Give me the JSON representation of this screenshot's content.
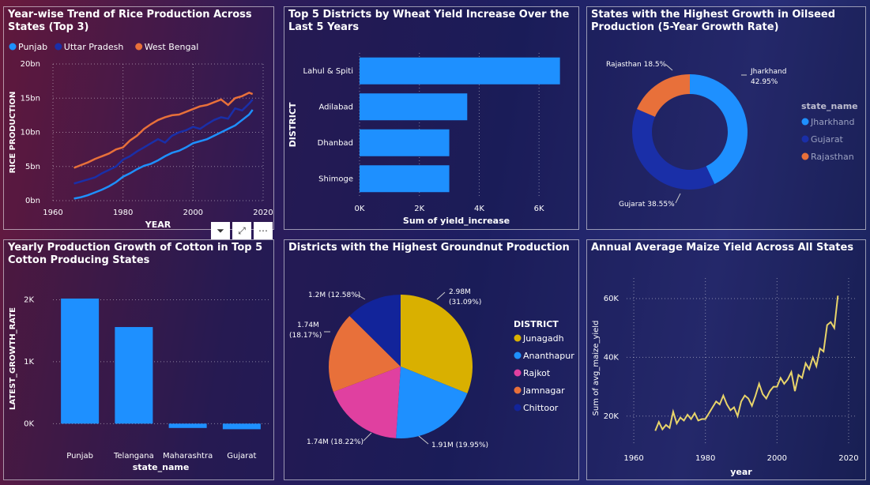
{
  "colors": {
    "blue": "#1e90ff",
    "navy": "#1a2fa8",
    "orange": "#e8703a",
    "pink": "#e040a0",
    "gold": "#d9b000",
    "yellow": "#e8d46a",
    "deepblue": "#12249a"
  },
  "toolbar": {
    "filter_icon": "filter-icon",
    "focus_icon": "focus-mode-icon",
    "more_icon": "more-options-icon",
    "filter_glyph": "⏷",
    "focus_glyph": "⤢",
    "more_glyph": "⋯"
  },
  "chart_data": [
    {
      "type": "line",
      "title": "Year-wise Trend of Rice Production Across States (Top 3)",
      "xlabel": "YEAR",
      "ylabel": "RICE PRODUCTION",
      "xticks": [
        "1960",
        "1980",
        "2000",
        "2020"
      ],
      "yticks": [
        "0bn",
        "5bn",
        "10bn",
        "15bn",
        "20bn"
      ],
      "xlim": [
        1960,
        2020
      ],
      "ylim": [
        0,
        20
      ],
      "legend": [
        "Punjab",
        "Uttar Pradesh",
        "West Bengal"
      ],
      "x": [
        1966,
        1968,
        1970,
        1972,
        1974,
        1976,
        1978,
        1980,
        1982,
        1984,
        1986,
        1988,
        1990,
        1992,
        1994,
        1996,
        1998,
        2000,
        2002,
        2004,
        2006,
        2008,
        2010,
        2012,
        2014,
        2016,
        2017
      ],
      "series": [
        {
          "name": "Punjab",
          "values": [
            0.3,
            0.5,
            0.8,
            1.2,
            1.6,
            2.1,
            2.7,
            3.5,
            4.0,
            4.6,
            5.1,
            5.4,
            5.9,
            6.5,
            7.0,
            7.3,
            7.8,
            8.4,
            8.7,
            9.0,
            9.5,
            10.0,
            10.5,
            11.0,
            11.8,
            12.6,
            13.3
          ]
        },
        {
          "name": "Uttar Pradesh",
          "values": [
            2.5,
            2.8,
            3.1,
            3.4,
            4.0,
            4.5,
            5.0,
            6.0,
            6.5,
            7.2,
            7.8,
            8.4,
            9.0,
            8.5,
            9.5,
            10.0,
            10.3,
            10.8,
            10.5,
            11.2,
            11.8,
            12.2,
            12.0,
            13.5,
            13.2,
            14.2,
            14.8
          ]
        },
        {
          "name": "West Bengal",
          "values": [
            4.8,
            5.2,
            5.6,
            6.1,
            6.5,
            6.9,
            7.5,
            7.8,
            8.8,
            9.5,
            10.5,
            11.2,
            11.8,
            12.2,
            12.5,
            12.6,
            13.0,
            13.4,
            13.8,
            14.0,
            14.4,
            14.8,
            14.0,
            15.0,
            15.3,
            15.8,
            15.6
          ]
        }
      ]
    },
    {
      "type": "bar",
      "title": "Top 5 Districts by Wheat Yield Increase Over the Last 5 Years",
      "xlabel": "Sum of yield_increase",
      "ylabel": "DISTRICT",
      "categories": [
        "Lahul & Spiti",
        "Adilabad",
        "Dhanbad",
        "Shimoge"
      ],
      "values": [
        6700,
        3600,
        3000,
        3000
      ],
      "xticks": [
        "0K",
        "2K",
        "4K",
        "6K"
      ],
      "xlim": [
        0,
        7000
      ]
    },
    {
      "type": "pie",
      "title": "States with the Highest Growth in Oilseed Production (5-Year Growth Rate)",
      "legend_title": "state_name",
      "categories": [
        "Jharkhand",
        "Gujarat",
        "Rajasthan"
      ],
      "values": [
        42.95,
        38.55,
        18.5
      ],
      "labels": [
        "Jharkhand",
        "42.95%",
        "Gujarat 38.55%",
        "Rajasthan 18.5%"
      ]
    },
    {
      "type": "bar",
      "title": "Yearly Production Growth of Cotton in Top 5 Cotton Producing States",
      "xlabel": "state_name",
      "ylabel": "LATEST_GROWTH_RATE",
      "categories": [
        "Punjab",
        "Telangana",
        "Maharashtra",
        "Gujarat"
      ],
      "values": [
        2020,
        1560,
        -70,
        -90
      ],
      "yticks": [
        "0K",
        "1K",
        "2K"
      ],
      "ylim": [
        -200,
        2300
      ]
    },
    {
      "type": "pie",
      "title": "Districts with the Highest Groundnut Production",
      "legend_title": "DISTRICT",
      "categories": [
        "Junagadh",
        "Ananthapur",
        "Rajkot",
        "Jamnagar",
        "Chittoor"
      ],
      "values": [
        31.09,
        19.95,
        18.22,
        18.17,
        12.58
      ],
      "labels": [
        "2.98M",
        "(31.09%)",
        "1.91M (19.95%)",
        "1.74M (18.22%)",
        "1.74M",
        "(18.17%)",
        "1.2M (12.58%)"
      ]
    },
    {
      "type": "line",
      "title": "Annual Average Maize Yield Across All States",
      "xlabel": "year",
      "ylabel": "Sum of avg_maize_yield",
      "xticks": [
        "1960",
        "1980",
        "2000",
        "2020"
      ],
      "yticks": [
        "20K",
        "40K",
        "60K"
      ],
      "xlim": [
        1958,
        2022
      ],
      "ylim": [
        10000,
        67000
      ],
      "x": [
        1966,
        1967,
        1968,
        1969,
        1970,
        1971,
        1972,
        1973,
        1974,
        1975,
        1976,
        1977,
        1978,
        1979,
        1980,
        1981,
        1982,
        1983,
        1984,
        1985,
        1986,
        1987,
        1988,
        1989,
        1990,
        1991,
        1992,
        1993,
        1994,
        1995,
        1996,
        1997,
        1998,
        1999,
        2000,
        2001,
        2002,
        2003,
        2004,
        2005,
        2006,
        2007,
        2008,
        2009,
        2010,
        2011,
        2012,
        2013,
        2014,
        2015,
        2016,
        2017
      ],
      "values": [
        15000,
        18000,
        15500,
        17000,
        16000,
        21500,
        17500,
        19500,
        18500,
        20500,
        19000,
        21000,
        18500,
        19000,
        19000,
        21000,
        23000,
        25000,
        24000,
        27000,
        24000,
        22000,
        23000,
        20000,
        25000,
        27000,
        26000,
        23500,
        27000,
        31000,
        27500,
        26000,
        28500,
        30000,
        30000,
        33000,
        31000,
        32500,
        35000,
        28500,
        34000,
        33000,
        38000,
        36000,
        40000,
        37000,
        43000,
        42000,
        51000,
        52000,
        50000,
        61000
      ]
    }
  ]
}
